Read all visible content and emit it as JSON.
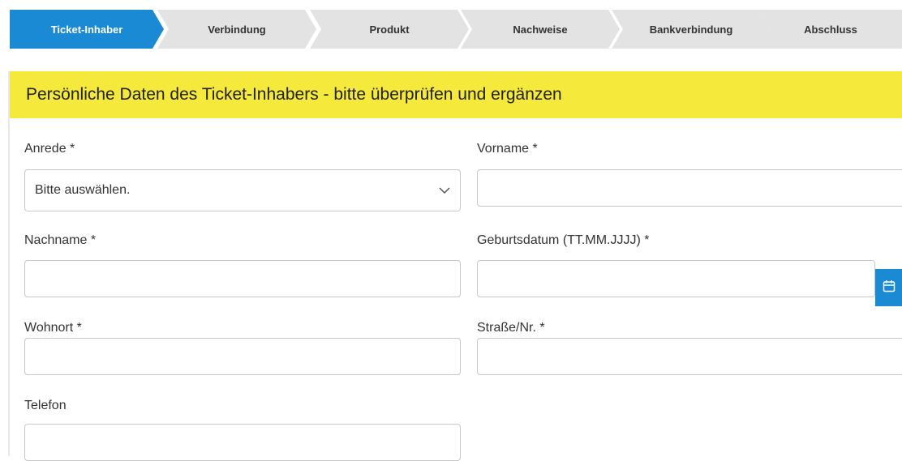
{
  "steps": [
    {
      "label": "Ticket-Inhaber",
      "active": true
    },
    {
      "label": "Verbindung",
      "active": false
    },
    {
      "label": "Produkt",
      "active": false
    },
    {
      "label": "Nachweise",
      "active": false
    },
    {
      "label": "Bankverbindung",
      "active": false
    },
    {
      "label": "Abschluss",
      "active": false
    }
  ],
  "section": {
    "title": "Persönliche Daten des Ticket-Inhabers - bitte überprüfen und ergänzen"
  },
  "form": {
    "anrede": {
      "label": "Anrede *",
      "value": "Bitte auswählen."
    },
    "vorname": {
      "label": "Vorname *",
      "value": ""
    },
    "nachname": {
      "label": "Nachname *",
      "value": ""
    },
    "geburtsdatum": {
      "label": "Geburtsdatum (TT.MM.JJJJ) *",
      "value": ""
    },
    "wohnort": {
      "label": "Wohnort *",
      "value": ""
    },
    "strasse": {
      "label": "Straße/Nr. *",
      "value": ""
    },
    "telefon": {
      "label": "Telefon",
      "value": ""
    }
  },
  "colors": {
    "accent": "#1a8ad4",
    "header_bg": "#f5e93b",
    "step_inactive": "#e3e3e3"
  },
  "icons": {
    "select": "chevron-down-icon",
    "date": "calendar-icon"
  }
}
